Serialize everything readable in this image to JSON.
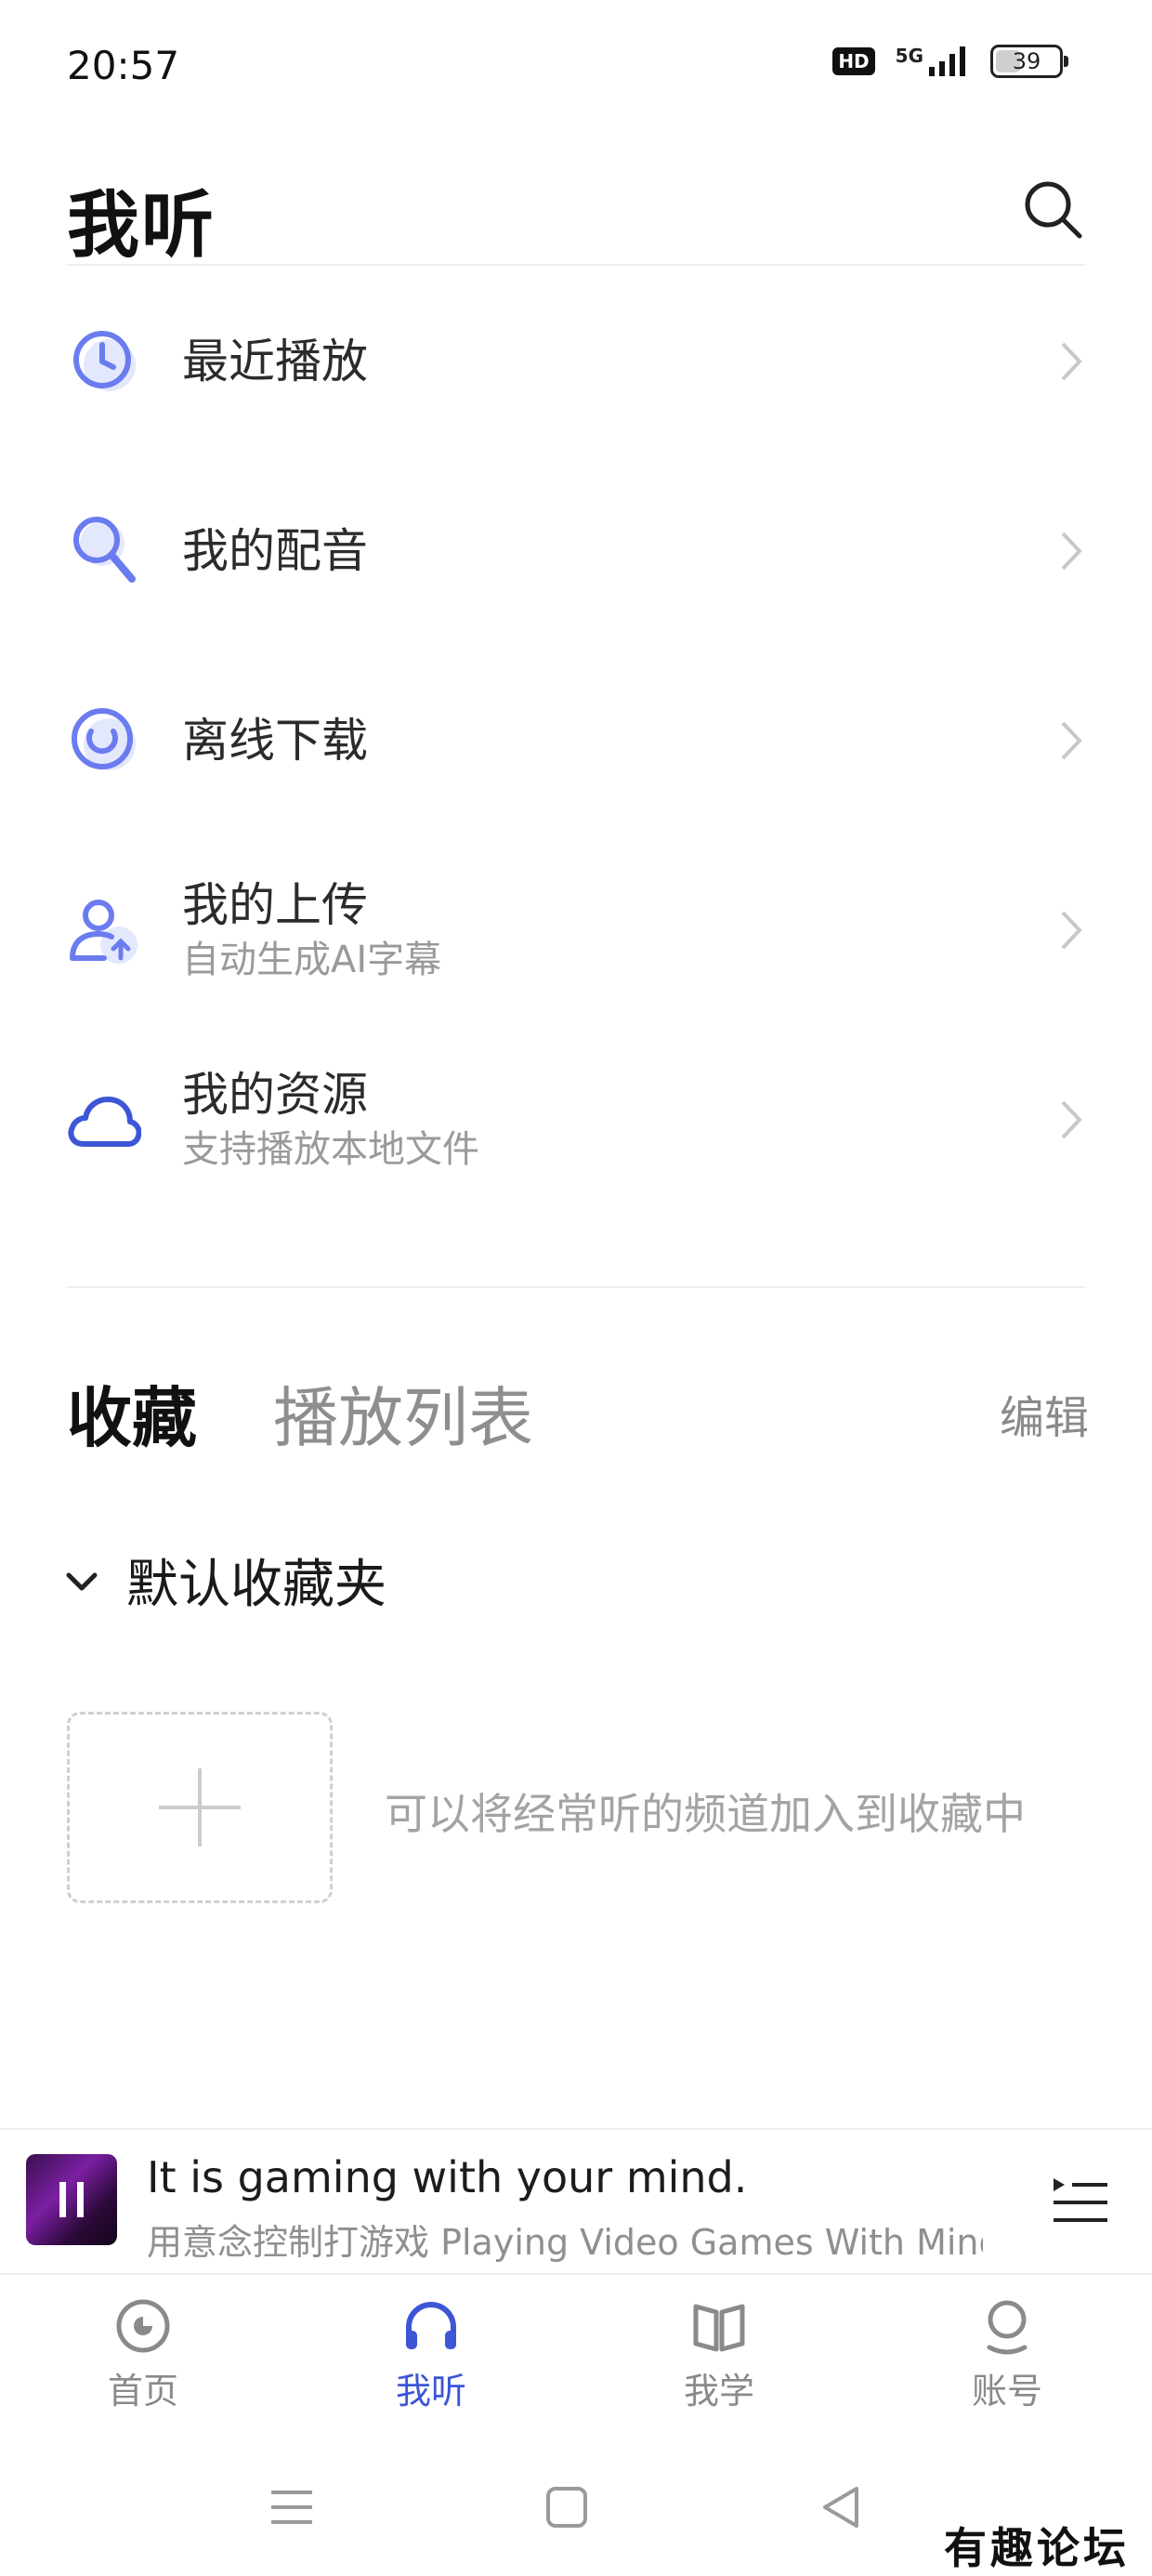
{
  "status_bar": {
    "time": "20:57",
    "hd": "HD",
    "network": "5G",
    "battery": "39",
    "battery_level": 0.39
  },
  "header": {
    "title": "我听"
  },
  "menu": [
    {
      "label": "最近播放",
      "sub": "",
      "icon": "clock-icon"
    },
    {
      "label": "我的配音",
      "sub": "",
      "icon": "microphone-icon"
    },
    {
      "label": "离线下载",
      "sub": "",
      "icon": "download-icon"
    },
    {
      "label": "我的上传",
      "sub": "自动生成AI字幕",
      "icon": "user-upload-icon"
    },
    {
      "label": "我的资源",
      "sub": "支持播放本地文件",
      "icon": "cloud-icon"
    }
  ],
  "tabs": {
    "favorites": "收藏",
    "playlist": "播放列表",
    "edit": "编辑"
  },
  "folder": {
    "label": "默认收藏夹"
  },
  "empty_hint": "可以将经常听的频道加入到收藏中",
  "player": {
    "title": "It is gaming with your mind.",
    "subtitle": "用意念控制打游戏 Playing Video Games With Mind..."
  },
  "bottom_nav": [
    {
      "label": "首页",
      "icon": "home-disc-icon"
    },
    {
      "label": "我听",
      "icon": "headphones-icon"
    },
    {
      "label": "我学",
      "icon": "book-icon"
    },
    {
      "label": "账号",
      "icon": "account-icon"
    }
  ],
  "watermark": "有趣论坛",
  "colors": {
    "accent": "#3d56d6",
    "icon_blue": "#6b7cf0"
  }
}
